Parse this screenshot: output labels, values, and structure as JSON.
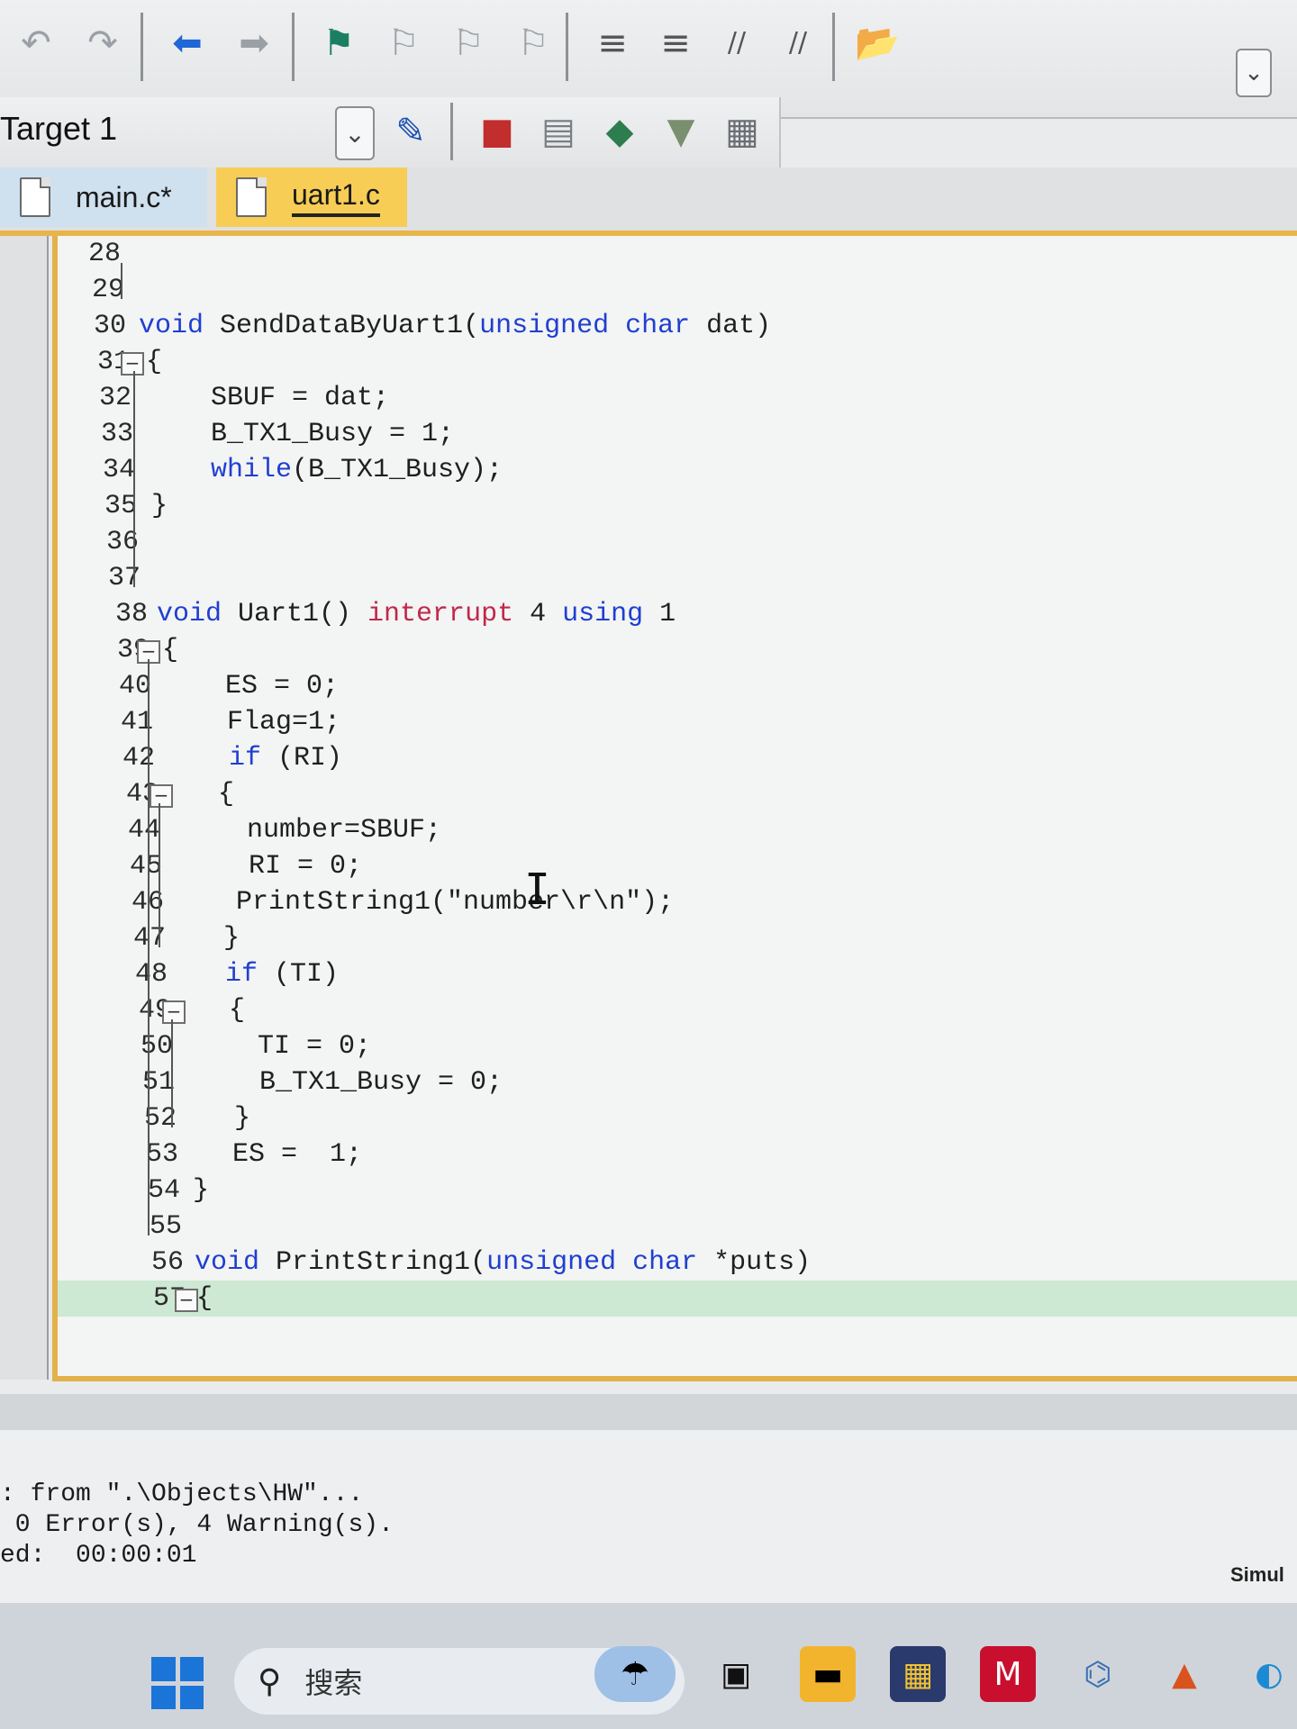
{
  "toolbar": {
    "undo_icon": "↶",
    "redo_icon": "↷",
    "back_icon": "⬅",
    "forward_icon": "➡",
    "bookmark_icon": "⚑",
    "bookmark_prev_icon": "⚐",
    "bookmark_next_icon": "⚐",
    "bookmark_clear_icon": "⚐",
    "indent_icon": "≡",
    "unindent_icon": "≡",
    "comment_icon": "//",
    "uncomment_icon": "//",
    "find_in_files_icon": "📂",
    "dropdown_icon": "⌄"
  },
  "build_toolbar": {
    "target": "Target 1",
    "dropdown_icon": "⌄",
    "wizard_icon": "✎",
    "manage_icon": "■",
    "options_icon": "▤",
    "pack_icon": "◆",
    "select_icon": "▼",
    "batch_icon": "▦"
  },
  "tabs": [
    {
      "label": "main.c*",
      "active": false
    },
    {
      "label": "uart1.c",
      "active": true
    }
  ],
  "editor": {
    "lines": [
      {
        "n": "28",
        "code": ""
      },
      {
        "n": "29",
        "code": ""
      },
      {
        "n": "30",
        "code": "void SendDataByUart1(unsigned char dat)"
      },
      {
        "n": "31",
        "code": "{"
      },
      {
        "n": "32",
        "code": "SBUF = dat;"
      },
      {
        "n": "33",
        "code": "B_TX1_Busy = 1;"
      },
      {
        "n": "34",
        "code": "while(B_TX1_Busy);"
      },
      {
        "n": "35",
        "code": "}"
      },
      {
        "n": "36",
        "code": ""
      },
      {
        "n": "37",
        "code": ""
      },
      {
        "n": "38",
        "code": "void Uart1() interrupt 4 using 1"
      },
      {
        "n": "39",
        "code": "{"
      },
      {
        "n": "40",
        "code": "ES = 0;"
      },
      {
        "n": "41",
        "code": "Flag=1;"
      },
      {
        "n": "42",
        "code": "if (RI)"
      },
      {
        "n": "43",
        "code": "{"
      },
      {
        "n": "44",
        "code": "number=SBUF;"
      },
      {
        "n": "45",
        "code": "RI = 0;"
      },
      {
        "n": "46",
        "code": "PrintString1(\"number\\r\\n\");"
      },
      {
        "n": "47",
        "code": "}"
      },
      {
        "n": "48",
        "code": "if (TI)"
      },
      {
        "n": "49",
        "code": "{"
      },
      {
        "n": "50",
        "code": "TI = 0;"
      },
      {
        "n": "51",
        "code": "B_TX1_Busy = 0;"
      },
      {
        "n": "52",
        "code": "}"
      },
      {
        "n": "53",
        "code": "ES =  1;"
      },
      {
        "n": "54",
        "code": "}"
      },
      {
        "n": "55",
        "code": ""
      },
      {
        "n": "56",
        "code": "void PrintString1(unsigned char *puts)"
      },
      {
        "n": "57",
        "code": "{"
      }
    ],
    "fold_icon": "−",
    "cursor_icon": "I"
  },
  "output": {
    "lines": [
      ": from \".\\Objects\\HW\"...",
      " 0 Error(s), 4 Warning(s).",
      "ed:  00:00:01"
    ],
    "status_right": "Simul"
  },
  "taskbar": {
    "search_icon": "⚲",
    "search_placeholder": "搜索",
    "apps": [
      "widgets",
      "task-view",
      "file-explorer",
      "store",
      "mcafee",
      "python",
      "matlab",
      "edge"
    ]
  },
  "colors": {
    "keyword": "#1f3fd0",
    "keyword_interrupt": "#c0284a",
    "active_tab": "#f8cd55",
    "editor_border": "#e2b14a",
    "current_line": "#cde8d3"
  }
}
